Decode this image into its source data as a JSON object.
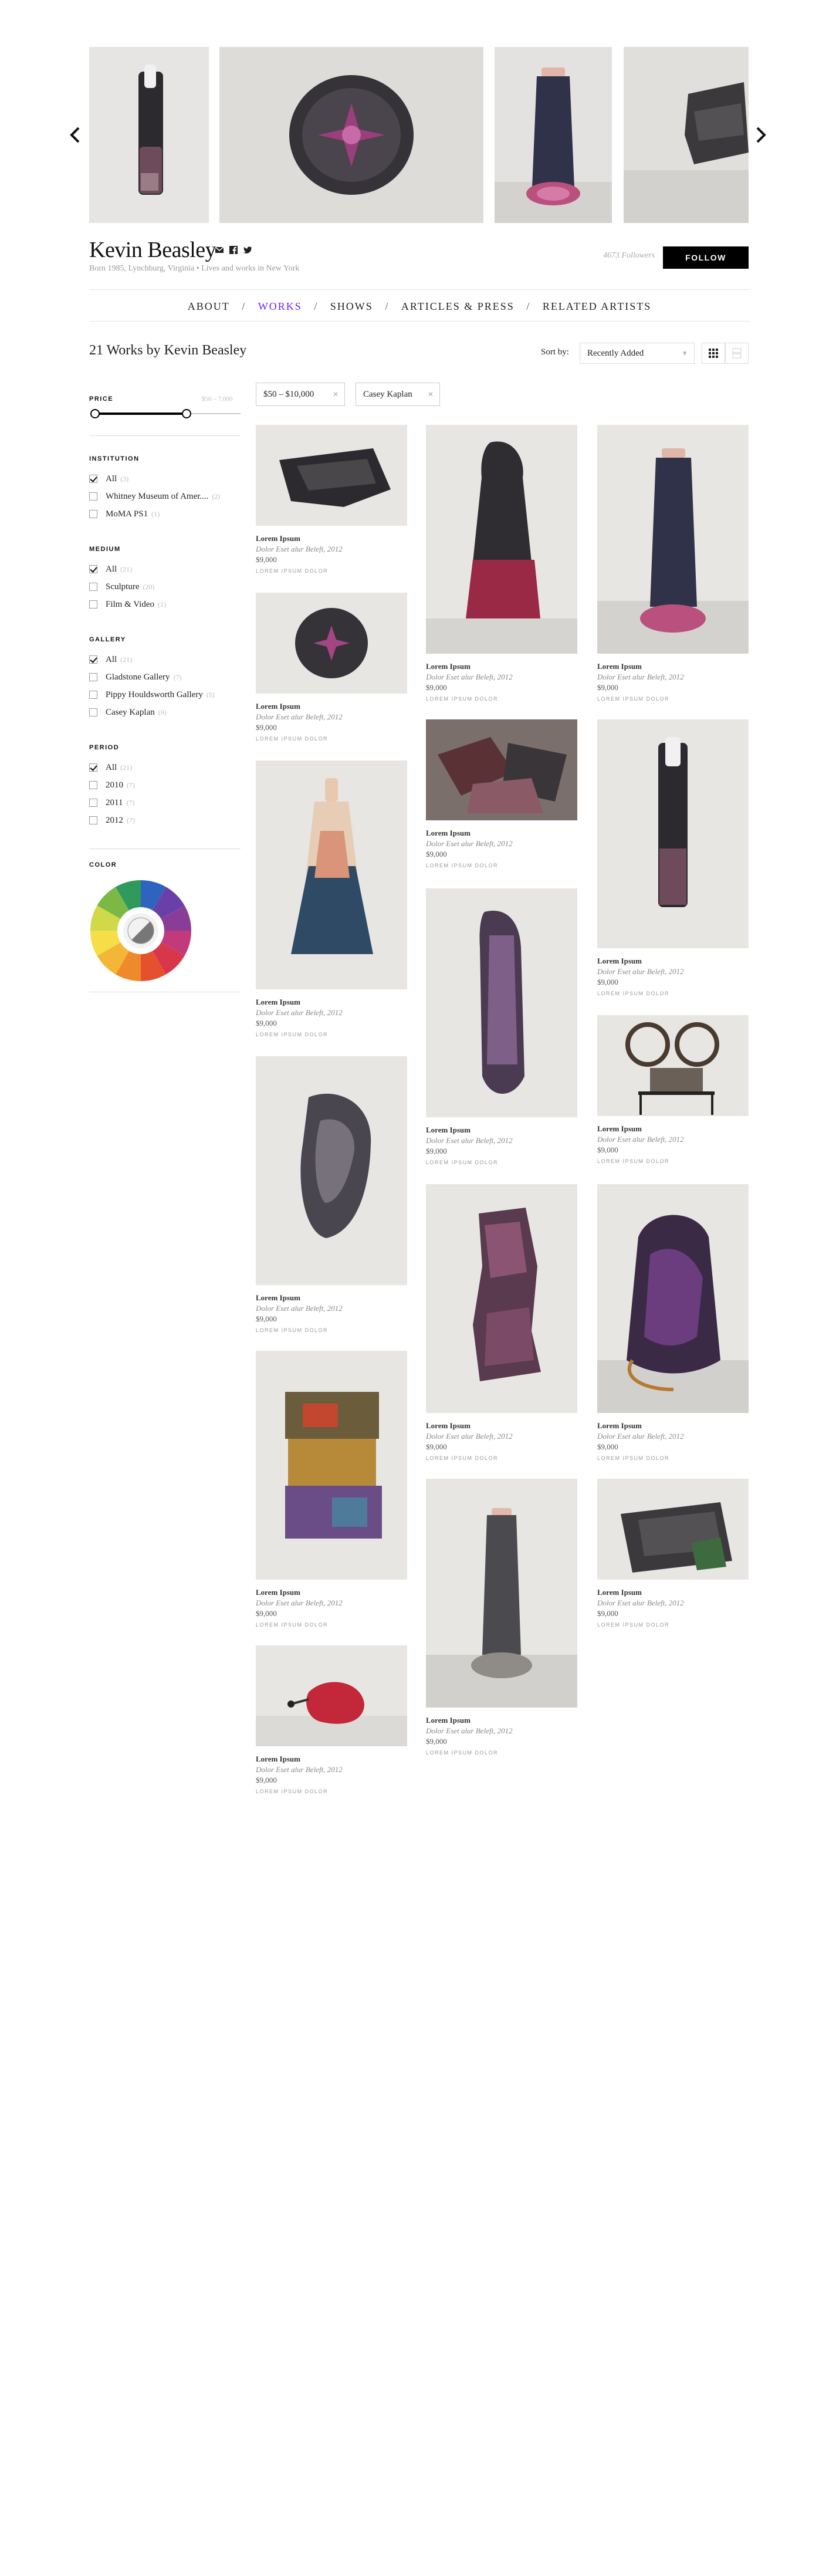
{
  "artist": {
    "name": "Kevin Beasley",
    "meta": "Born 1985, Lynchburg, Virginia • Lives and works in New York",
    "followers": "4673 Followers",
    "follow_label": "FOLLOW"
  },
  "share_icons": [
    "mail-icon",
    "facebook-icon",
    "twitter-icon"
  ],
  "nav": {
    "items": [
      "ABOUT",
      "WORKS",
      "SHOWS",
      "ARTICLES & PRESS",
      "RELATED ARTISTS"
    ],
    "separator": "/",
    "active": "WORKS",
    "active_color": "#6e1fff"
  },
  "works_header": {
    "title": "21 Works by Kevin Beasley",
    "sort_label": "Sort by:",
    "sort_value": "Recently Added"
  },
  "filters": {
    "price": {
      "heading": "PRICE",
      "range": "$50 – 7,000",
      "low_fraction": 0.0,
      "high_fraction": 0.63
    },
    "institution": {
      "heading": "INSTITUTION",
      "options": [
        {
          "label": "All",
          "count": "(3)",
          "checked": true
        },
        {
          "label": "Whitney Museum of Amer....",
          "count": "(2)",
          "checked": false
        },
        {
          "label": "MoMA PS1",
          "count": "(1)",
          "checked": false
        }
      ]
    },
    "medium": {
      "heading": "MEDIUM",
      "options": [
        {
          "label": "All",
          "count": "(21)",
          "checked": true
        },
        {
          "label": "Sculpture",
          "count": "(20)",
          "checked": false
        },
        {
          "label": "Film & Video",
          "count": "(1)",
          "checked": false
        }
      ]
    },
    "gallery": {
      "heading": "GALLERY",
      "options": [
        {
          "label": "All",
          "count": "(21)",
          "checked": true
        },
        {
          "label": "Gladstone Gallery",
          "count": "(7)",
          "checked": false
        },
        {
          "label": "Pippy Houldsworth Gallery",
          "count": "(5)",
          "checked": false
        },
        {
          "label": "Casey Kaplan",
          "count": "(9)",
          "checked": false
        }
      ]
    },
    "period": {
      "heading": "PERIOD",
      "options": [
        {
          "label": "All",
          "count": "(21)",
          "checked": true
        },
        {
          "label": "2010",
          "count": "(7)",
          "checked": false
        },
        {
          "label": "2011",
          "count": "(7)",
          "checked": false
        },
        {
          "label": "2012",
          "count": "(7)",
          "checked": false
        }
      ]
    },
    "color": {
      "heading": "COLOR",
      "swatches": [
        "#2f63c0",
        "#6a3fa8",
        "#8a3d96",
        "#c13b7a",
        "#d8364a",
        "#e5502e",
        "#ef8a2a",
        "#f4b637",
        "#f6de46",
        "#cfd94a",
        "#7cb944",
        "#2f9a5c"
      ]
    }
  },
  "active_filters": [
    "$50 – $10,000",
    "Casey Kaplan"
  ],
  "artwork_common": {
    "artist": "Lorem Ipsum",
    "title": "Dolor Eset alur Beleft, 2012",
    "price": "$9,000",
    "gallery": "LOREM IPSUM DOLOR"
  },
  "images": {
    "carousel": [
      "black-draped-pillar",
      "round-purple-disc",
      "inverted-blue-figure",
      "grey-block"
    ],
    "columns": [
      [
        "black-fabric-lump",
        "round-purple-disc",
        "hanging-dress",
        "grey-face-mask",
        "stacked-colored-blocks",
        "red-object-floor"
      ],
      [
        "hooded-magenta-figure",
        "folded-clothes-pile",
        "tall-purple-form",
        "tall-rose-block",
        "grey-stone-pillar"
      ],
      [
        "inverted-blue-figure",
        "black-draped-pillar",
        "film-projector",
        "purple-fabric-bag",
        "grey-block"
      ]
    ]
  }
}
